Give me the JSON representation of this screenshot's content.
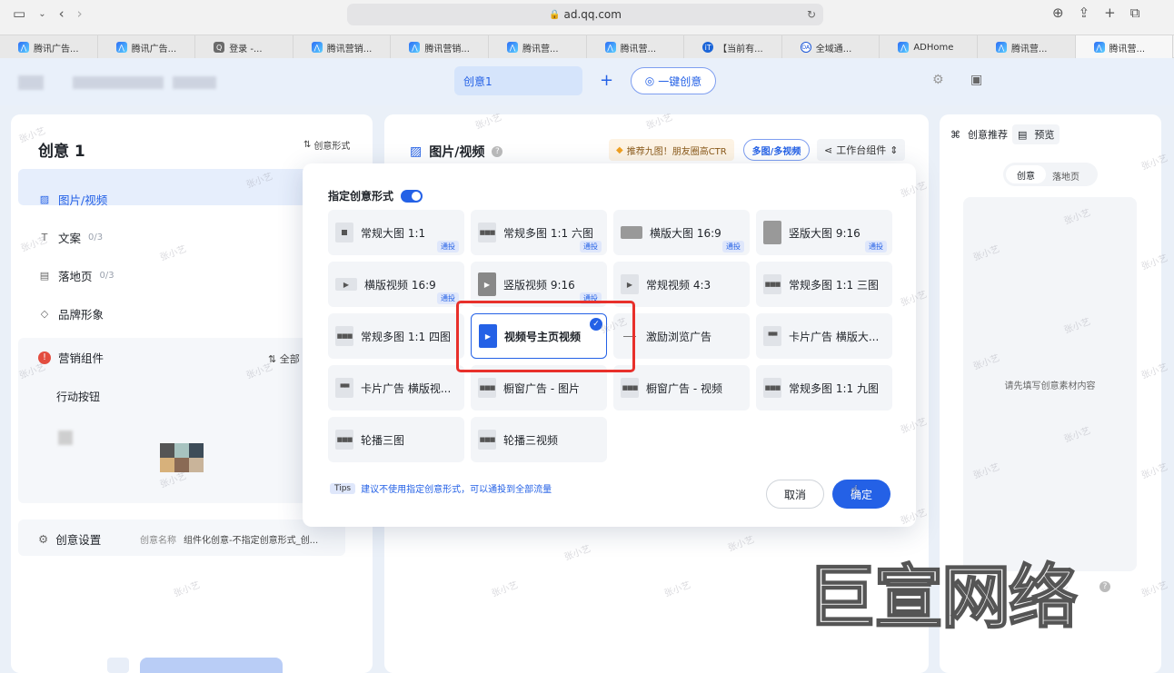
{
  "browser": {
    "url": "ad.qq.com",
    "tabs": [
      {
        "label": "腾讯广告...",
        "fav": "logo"
      },
      {
        "label": "腾讯广告...",
        "fav": "logo"
      },
      {
        "label": "登录 -...",
        "fav": "q"
      },
      {
        "label": "腾讯营销...",
        "fav": "logo"
      },
      {
        "label": "腾讯营销...",
        "fav": "logo"
      },
      {
        "label": "腾讯营...",
        "fav": "logo"
      },
      {
        "label": "腾讯营...",
        "fav": "logo"
      },
      {
        "label": "【当前有...",
        "fav": "it"
      },
      {
        "label": "全域通...",
        "fav": "oa"
      },
      {
        "label": "ADHome",
        "fav": "logo"
      },
      {
        "label": "腾讯营...",
        "fav": "logo"
      },
      {
        "label": "腾讯营...",
        "fav": "logo"
      }
    ]
  },
  "topbar": {
    "creative_tab": "创意1",
    "plus": "+",
    "one_click": "一键创意"
  },
  "left": {
    "title": "创意 1",
    "form_btn": "创意形式",
    "nav": [
      {
        "label": "图片/视频",
        "count": "",
        "icon": "image-icon"
      },
      {
        "label": "文案",
        "count": "0/3",
        "icon": "text-icon"
      },
      {
        "label": "落地页",
        "count": "0/3",
        "icon": "page-icon"
      },
      {
        "label": "品牌形象",
        "count": "",
        "icon": "tag-icon"
      }
    ],
    "marketing": "营销组件",
    "all": "全部",
    "action_button": "行动按钮",
    "settings": "创意设置",
    "settings_name_label": "创意名称",
    "settings_name_value": "组件化创意-不指定创意形式_创..."
  },
  "mid": {
    "title": "图片/视频",
    "promo": "推荐九图！朋友圈高CTR",
    "multi": "多图/多视频",
    "workbench": "工作台组件"
  },
  "right": {
    "recommend": "创意推荐",
    "preview": "预览",
    "seg_creative": "创意",
    "seg_landing": "落地页",
    "placeholder": "请先填写创意素材内容"
  },
  "modal": {
    "toggle_label": "指定创意形式",
    "toggle_on": true,
    "formats": [
      {
        "label": "常规大图 1:1",
        "thumb": "sq-dot",
        "badge": "通投"
      },
      {
        "label": "常规多图 1:1 六图",
        "thumb": "sq-dots",
        "badge": "通投"
      },
      {
        "label": "横版大图 16:9",
        "thumb": "wide",
        "badge": "通投"
      },
      {
        "label": "竖版大图 9:16",
        "thumb": "tall",
        "badge": "通投"
      },
      {
        "label": "横版视频 16:9",
        "thumb": "wide-play",
        "badge": "通投"
      },
      {
        "label": "竖版视频 9:16",
        "thumb": "tall-play",
        "badge": "通投"
      },
      {
        "label": "常规视频  4:3",
        "thumb": "sq-play",
        "badge": ""
      },
      {
        "label": "常规多图 1:1 三图",
        "thumb": "sq-dots",
        "badge": ""
      },
      {
        "label": "常规多图 1:1 四图",
        "thumb": "sq-dots",
        "badge": ""
      },
      {
        "label": "视频号主页视频",
        "thumb": "blue-play",
        "badge": "",
        "selected": true
      },
      {
        "label": "激励浏览广告",
        "thumb": "line",
        "badge": ""
      },
      {
        "label": "卡片广告 横版大...",
        "thumb": "card",
        "badge": ""
      },
      {
        "label": "卡片广告 横版视...",
        "thumb": "card",
        "badge": ""
      },
      {
        "label": "橱窗广告 - 图片",
        "thumb": "sq-dots",
        "badge": ""
      },
      {
        "label": "橱窗广告 - 视频",
        "thumb": "sq-dots",
        "badge": ""
      },
      {
        "label": "常规多图 1:1 九图",
        "thumb": "sq-dots",
        "badge": ""
      },
      {
        "label": "轮播三图",
        "thumb": "sq-dots",
        "badge": ""
      },
      {
        "label": "轮播三视频",
        "thumb": "sq-dots",
        "badge": ""
      }
    ],
    "tips_tag": "Tips",
    "tips_text": "建议不使用指定创意形式，可以通投到全部流量",
    "cancel": "取消",
    "confirm": "确定"
  },
  "watermark": {
    "small": "张小艺",
    "big": "巨宣网络"
  },
  "colors": {
    "accent": "#2461e6",
    "highlight": "#e8302b"
  }
}
